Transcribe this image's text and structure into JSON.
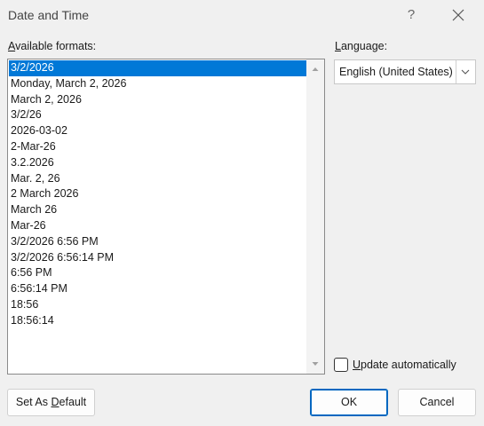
{
  "window": {
    "title": "Date and Time",
    "help_glyph": "?"
  },
  "formats": {
    "label_prefix": "",
    "label_mnemonic": "A",
    "label_rest": "vailable formats:",
    "items": [
      "3/2/2026",
      "Monday, March 2, 2026",
      "March 2, 2026",
      "3/2/26",
      "2026-03-02",
      "2-Mar-26",
      "3.2.2026",
      "Mar. 2, 26",
      "2 March 2026",
      "March 26",
      "Mar-26",
      "3/2/2026 6:56 PM",
      "3/2/2026 6:56:14 PM",
      "6:56 PM",
      "6:56:14 PM",
      "18:56",
      "18:56:14"
    ],
    "selected_index": 0
  },
  "language": {
    "label_mnemonic": "L",
    "label_rest": "anguage:",
    "value": "English (United States)"
  },
  "update": {
    "label_mnemonic": "U",
    "label_rest": "pdate automatically",
    "checked": false
  },
  "buttons": {
    "default_prefix": "Set As ",
    "default_mnemonic": "D",
    "default_rest": "efault",
    "ok": "OK",
    "cancel": "Cancel"
  },
  "colors": {
    "selection": "#0078d7",
    "ok_border": "#0067c0"
  }
}
